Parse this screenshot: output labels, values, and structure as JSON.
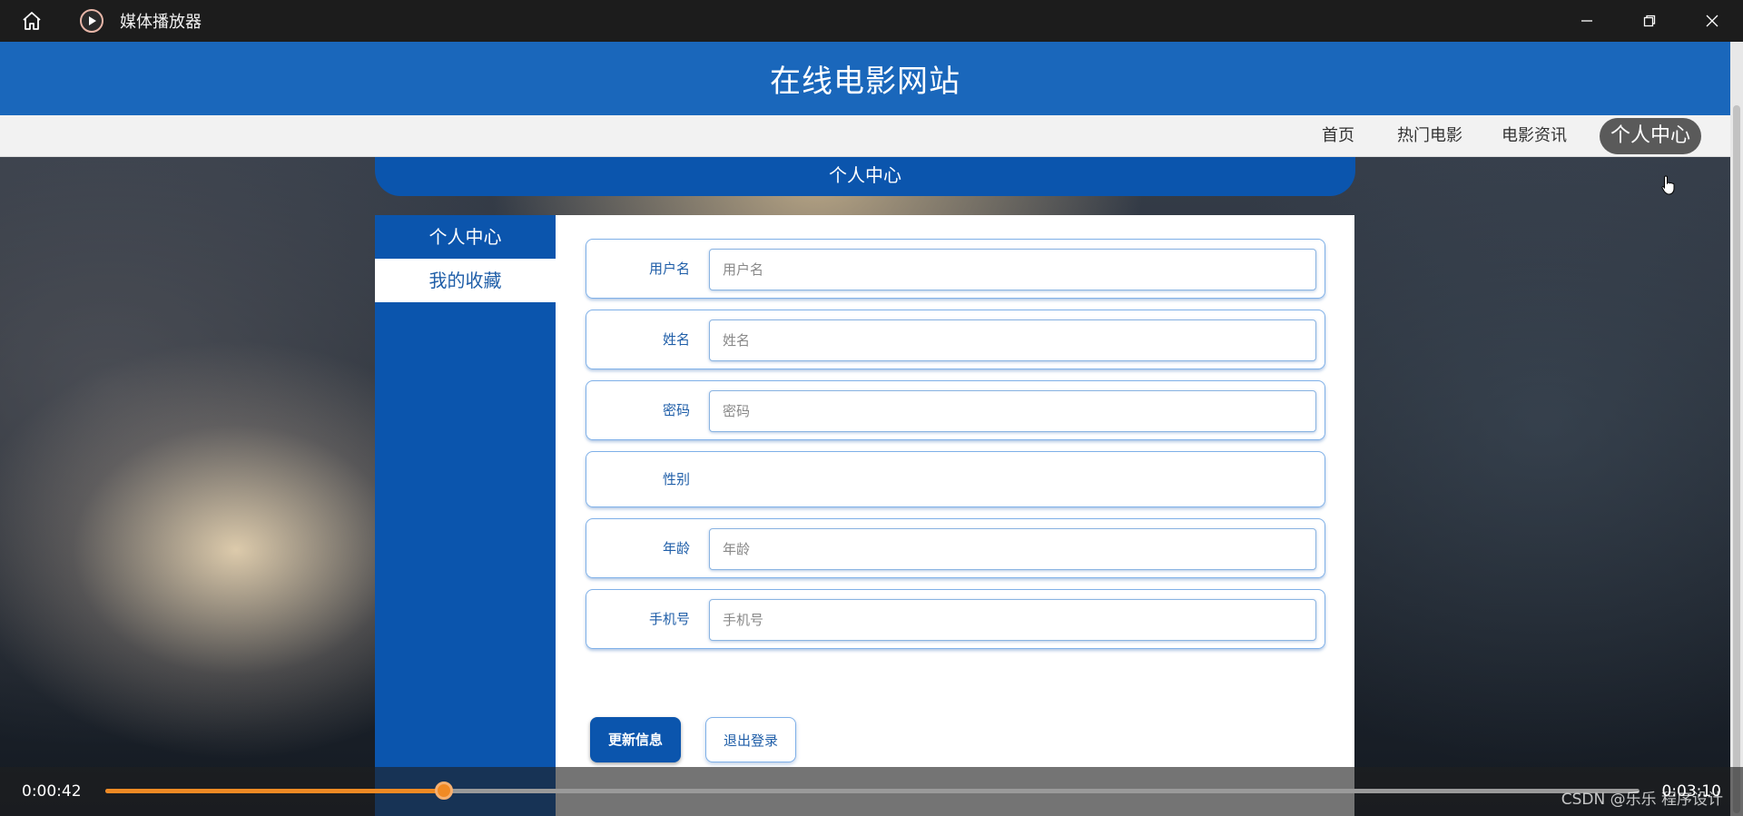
{
  "window": {
    "title": "媒体播放器"
  },
  "site": {
    "title": "在线电影网站",
    "nav": [
      "首页",
      "热门电影",
      "电影资讯",
      "个人中心"
    ],
    "active_nav": "个人中心"
  },
  "page": {
    "section_title": "个人中心",
    "side_menu": [
      "个人中心",
      "我的收藏"
    ],
    "form": {
      "fields": [
        {
          "label": "用户名",
          "placeholder": "用户名"
        },
        {
          "label": "姓名",
          "placeholder": "姓名"
        },
        {
          "label": "密码",
          "placeholder": "密码"
        },
        {
          "label": "性别",
          "placeholder": ""
        },
        {
          "label": "年龄",
          "placeholder": "年龄"
        },
        {
          "label": "手机号",
          "placeholder": "手机号"
        }
      ],
      "update_button": "更新信息",
      "logout_button": "退出登录"
    }
  },
  "player": {
    "current_time": "0:00:42",
    "total_time": "0:03:10",
    "progress": 0.221,
    "watermark": "CSDN @乐乐 程序设计"
  },
  "colors": {
    "brand_blue": "#1a67bb",
    "deep_blue": "#0b55ad",
    "progress_orange": "#f08a24"
  }
}
